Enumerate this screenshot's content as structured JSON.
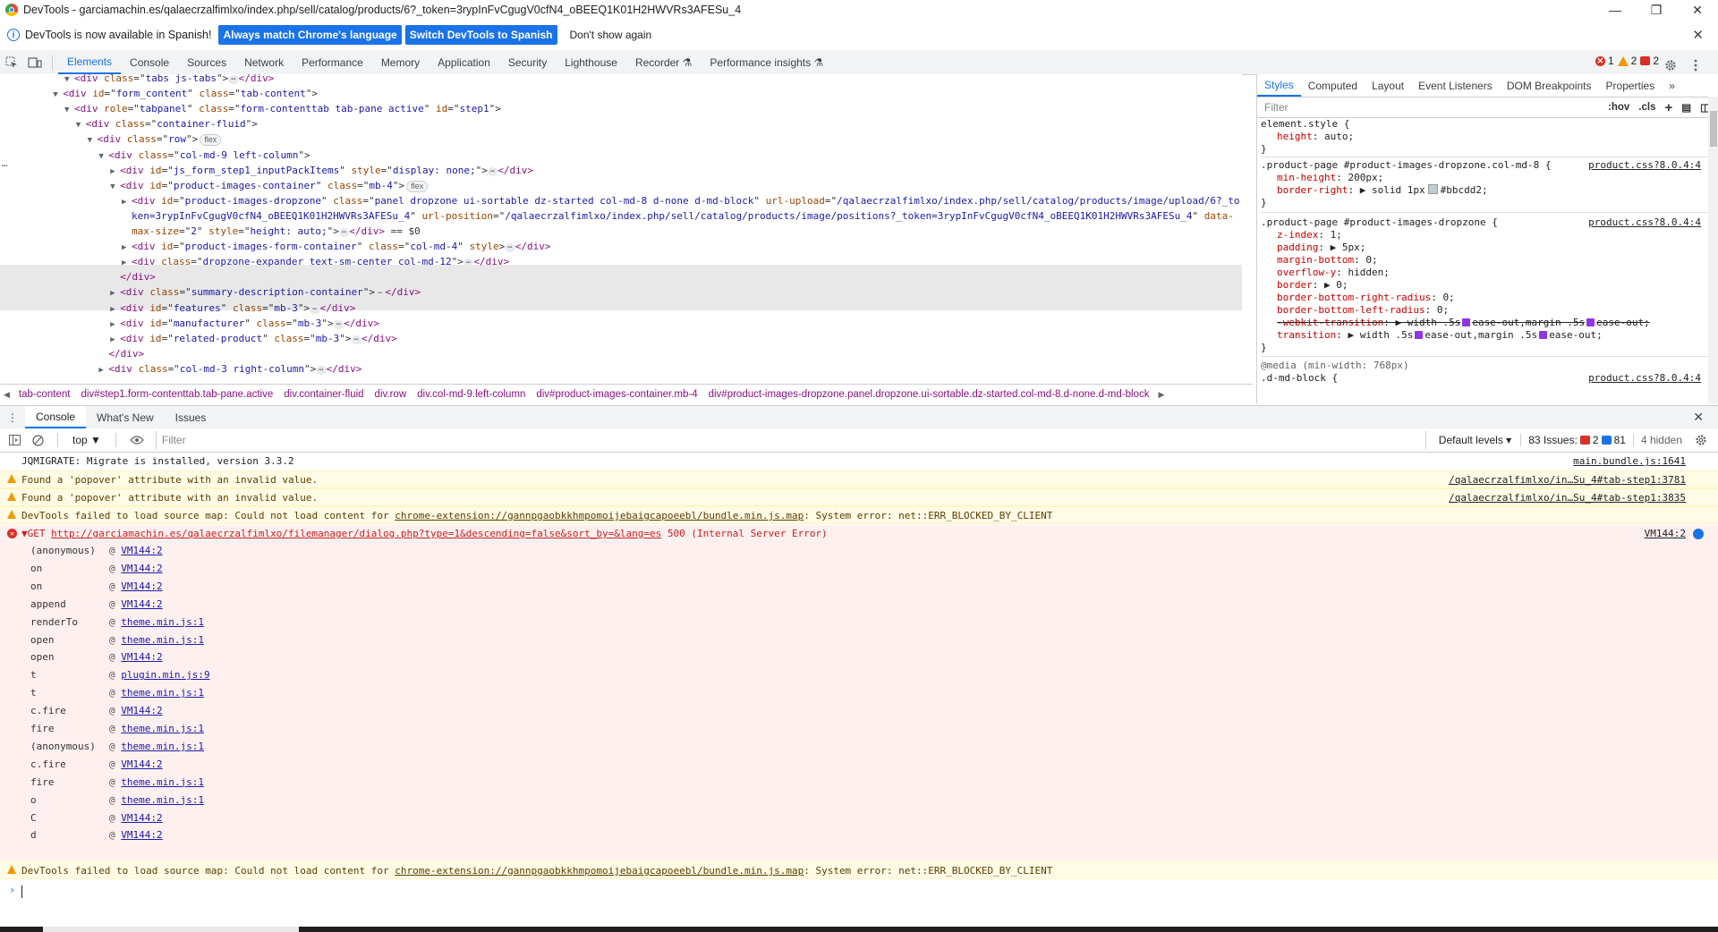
{
  "window": {
    "title": "DevTools - garciamachin.es/qalaecrzalfimlxo/index.php/sell/catalog/products/6?_token=3rypInFvCgugV0cfN4_oBEEQ1K01H2HWVRs3AFESu_4",
    "minimize": "—",
    "restore": "❐",
    "close": "✕"
  },
  "infobar": {
    "message": "DevTools is now available in Spanish!",
    "button_match": "Always match Chrome's language",
    "button_switch": "Switch DevTools to Spanish",
    "button_dismiss": "Don't show again",
    "close": "✕"
  },
  "main_tabs": [
    "Elements",
    "Console",
    "Sources",
    "Network",
    "Performance",
    "Memory",
    "Application",
    "Security",
    "Lighthouse",
    "Recorder ⚗",
    "Performance insights ⚗"
  ],
  "badges": {
    "errors": "1",
    "warnings": "2",
    "issues": "2"
  },
  "dom_lines": [
    {
      "indent": 5,
      "tri": "▼",
      "html": "<div class=\"tabs js-tabs\">…</div>",
      "parts": [
        [
          "tag",
          "<div "
        ],
        [
          "attr",
          "class"
        ],
        [
          "plain",
          "=\""
        ],
        [
          "val",
          "tabs js-tabs"
        ],
        [
          "plain",
          "\">"
        ],
        [
          "dots",
          "⋯"
        ],
        [
          "tag",
          "</div>"
        ]
      ]
    },
    {
      "indent": 4,
      "tri": "▼",
      "parts": [
        [
          "tag",
          "<div "
        ],
        [
          "attr",
          "id"
        ],
        [
          "plain",
          "=\""
        ],
        [
          "val",
          "form_content"
        ],
        [
          "plain",
          "\" "
        ],
        [
          "attr",
          "class"
        ],
        [
          "plain",
          "=\""
        ],
        [
          "val",
          "tab-content"
        ],
        [
          "plain",
          "\">"
        ]
      ]
    },
    {
      "indent": 5,
      "tri": "▼",
      "parts": [
        [
          "tag",
          "<div "
        ],
        [
          "attr",
          "role"
        ],
        [
          "plain",
          "=\""
        ],
        [
          "val",
          "tabpanel"
        ],
        [
          "plain",
          "\" "
        ],
        [
          "attr",
          "class"
        ],
        [
          "plain",
          "=\""
        ],
        [
          "val",
          "form-contenttab tab-pane active"
        ],
        [
          "plain",
          "\" "
        ],
        [
          "attr",
          "id"
        ],
        [
          "plain",
          "=\""
        ],
        [
          "val",
          "step1"
        ],
        [
          "plain",
          "\">"
        ]
      ]
    },
    {
      "indent": 6,
      "tri": "▼",
      "parts": [
        [
          "tag",
          "<div "
        ],
        [
          "attr",
          "class"
        ],
        [
          "plain",
          "=\""
        ],
        [
          "val",
          "container-fluid"
        ],
        [
          "plain",
          "\">"
        ]
      ]
    },
    {
      "indent": 7,
      "tri": "▼",
      "parts": [
        [
          "tag",
          "<div "
        ],
        [
          "attr",
          "class"
        ],
        [
          "plain",
          "=\""
        ],
        [
          "val",
          "row"
        ],
        [
          "plain",
          "\">"
        ],
        [
          "pill",
          "flex"
        ]
      ]
    },
    {
      "indent": 8,
      "tri": "▼",
      "parts": [
        [
          "tag",
          "<div "
        ],
        [
          "attr",
          "class"
        ],
        [
          "plain",
          "=\""
        ],
        [
          "val",
          "col-md-9 left-column"
        ],
        [
          "plain",
          "\">"
        ]
      ]
    },
    {
      "indent": 9,
      "tri": "▶",
      "parts": [
        [
          "tag",
          "<div "
        ],
        [
          "attr",
          "id"
        ],
        [
          "plain",
          "=\""
        ],
        [
          "val",
          "js_form_step1_inputPackItems"
        ],
        [
          "plain",
          "\" "
        ],
        [
          "attr",
          "style"
        ],
        [
          "plain",
          "=\""
        ],
        [
          "val",
          "display: none;"
        ],
        [
          "plain",
          "\">"
        ],
        [
          "dots",
          "⋯"
        ],
        [
          "tag",
          "</div>"
        ]
      ]
    },
    {
      "indent": 9,
      "tri": "▼",
      "parts": [
        [
          "tag",
          "<div "
        ],
        [
          "attr",
          "id"
        ],
        [
          "plain",
          "=\""
        ],
        [
          "val",
          "product-images-container"
        ],
        [
          "plain",
          "\" "
        ],
        [
          "attr",
          "class"
        ],
        [
          "plain",
          "=\""
        ],
        [
          "val",
          "mb-4"
        ],
        [
          "plain",
          "\">"
        ],
        [
          "pill",
          "flex"
        ]
      ]
    },
    {
      "indent": 10,
      "tri": "▶",
      "parts": [
        [
          "tag",
          "<div "
        ],
        [
          "attr",
          "id"
        ],
        [
          "plain",
          "=\""
        ],
        [
          "val",
          "product-images-dropzone"
        ],
        [
          "plain",
          "\" "
        ],
        [
          "attr",
          "class"
        ],
        [
          "plain",
          "=\""
        ],
        [
          "val",
          "panel dropzone ui-sortable dz-started col-md-8 d-none d-md-block"
        ],
        [
          "plain",
          "\" "
        ],
        [
          "attr",
          "url-upload"
        ],
        [
          "plain",
          "=\""
        ],
        [
          "val",
          "/qalaecrzalfimlxo/index.php/sell/catalog/products/image/upload/6?_to"
        ]
      ]
    },
    {
      "indent": 10,
      "tri": "",
      "parts": [
        [
          "val",
          "ken=3rypInFvCgugV0cfN4_oBEEQ1K01H2HWVRs3AFESu_4"
        ],
        [
          "plain",
          "\" "
        ],
        [
          "attr",
          "url-position"
        ],
        [
          "plain",
          "=\""
        ],
        [
          "val",
          "/qalaecrzalfimlxo/index.php/sell/catalog/products/image/positions?_token=3rypInFvCgugV0cfN4_oBEEQ1K01H2HWVRs3AFESu_4"
        ],
        [
          "plain",
          "\" "
        ],
        [
          "attr",
          "data-"
        ]
      ]
    },
    {
      "indent": 10,
      "tri": "",
      "parts": [
        [
          "attr",
          "max-size"
        ],
        [
          "plain",
          "=\""
        ],
        [
          "val",
          "2"
        ],
        [
          "plain",
          "\" "
        ],
        [
          "attr",
          "style"
        ],
        [
          "plain",
          "=\""
        ],
        [
          "val",
          "height: auto;"
        ],
        [
          "plain",
          "\">"
        ],
        [
          "dots",
          "⋯"
        ],
        [
          "tag",
          "</div>"
        ],
        [
          "plain",
          " == $0"
        ]
      ]
    },
    {
      "indent": 10,
      "tri": "▶",
      "parts": [
        [
          "tag",
          "<div "
        ],
        [
          "attr",
          "id"
        ],
        [
          "plain",
          "=\""
        ],
        [
          "val",
          "product-images-form-container"
        ],
        [
          "plain",
          "\" "
        ],
        [
          "attr",
          "class"
        ],
        [
          "plain",
          "=\""
        ],
        [
          "val",
          "col-md-4"
        ],
        [
          "plain",
          "\" "
        ],
        [
          "attr",
          "style"
        ],
        [
          "plain",
          ">"
        ],
        [
          "dots",
          "⋯"
        ],
        [
          "tag",
          "</div>"
        ]
      ]
    },
    {
      "indent": 10,
      "tri": "▶",
      "parts": [
        [
          "tag",
          "<div "
        ],
        [
          "attr",
          "class"
        ],
        [
          "plain",
          "=\""
        ],
        [
          "val",
          "dropzone-expander text-sm-center col-md-12"
        ],
        [
          "plain",
          "\">"
        ],
        [
          "dots",
          "⋯"
        ],
        [
          "tag",
          "</div>"
        ]
      ]
    },
    {
      "indent": 9,
      "tri": "",
      "parts": [
        [
          "tag",
          "</div>"
        ]
      ]
    },
    {
      "indent": 9,
      "tri": "▶",
      "parts": [
        [
          "tag",
          "<div "
        ],
        [
          "attr",
          "class"
        ],
        [
          "plain",
          "=\""
        ],
        [
          "val",
          "summary-description-container"
        ],
        [
          "plain",
          "\">"
        ],
        [
          "dots",
          "⋯"
        ],
        [
          "tag",
          "</div>"
        ]
      ]
    },
    {
      "indent": 9,
      "tri": "▶",
      "parts": [
        [
          "tag",
          "<div "
        ],
        [
          "attr",
          "id"
        ],
        [
          "plain",
          "=\""
        ],
        [
          "val",
          "features"
        ],
        [
          "plain",
          "\" "
        ],
        [
          "attr",
          "class"
        ],
        [
          "plain",
          "=\""
        ],
        [
          "val",
          "mb-3"
        ],
        [
          "plain",
          "\">"
        ],
        [
          "dots",
          "⋯"
        ],
        [
          "tag",
          "</div>"
        ]
      ]
    },
    {
      "indent": 9,
      "tri": "▶",
      "parts": [
        [
          "tag",
          "<div "
        ],
        [
          "attr",
          "id"
        ],
        [
          "plain",
          "=\""
        ],
        [
          "val",
          "manufacturer"
        ],
        [
          "plain",
          "\" "
        ],
        [
          "attr",
          "class"
        ],
        [
          "plain",
          "=\""
        ],
        [
          "val",
          "mb-3"
        ],
        [
          "plain",
          "\">"
        ],
        [
          "dots",
          "⋯"
        ],
        [
          "tag",
          "</div>"
        ]
      ]
    },
    {
      "indent": 9,
      "tri": "▶",
      "parts": [
        [
          "tag",
          "<div "
        ],
        [
          "attr",
          "id"
        ],
        [
          "plain",
          "=\""
        ],
        [
          "val",
          "related-product"
        ],
        [
          "plain",
          "\" "
        ],
        [
          "attr",
          "class"
        ],
        [
          "plain",
          "=\""
        ],
        [
          "val",
          "mb-3"
        ],
        [
          "plain",
          "\">"
        ],
        [
          "dots",
          "⋯"
        ],
        [
          "tag",
          "</div>"
        ]
      ]
    },
    {
      "indent": 8,
      "tri": "",
      "parts": [
        [
          "tag",
          "</div>"
        ]
      ]
    },
    {
      "indent": 8,
      "tri": "▶",
      "parts": [
        [
          "tag",
          "<div "
        ],
        [
          "attr",
          "class"
        ],
        [
          "plain",
          "=\""
        ],
        [
          "val",
          "col-md-3 right-column"
        ],
        [
          "plain",
          "\">"
        ],
        [
          "dots",
          "⋯"
        ],
        [
          "tag",
          "</div>"
        ]
      ]
    }
  ],
  "breadcrumb": [
    "tab-content",
    "div#step1.form-contenttab.tab-pane.active",
    "div.container-fluid",
    "div.row",
    "div.col-md-9.left-column",
    "div#product-images-container.mb-4",
    "div#product-images-dropzone.panel.dropzone.ui-sortable.dz-started.col-md-8.d-none.d-md-block"
  ],
  "styles_tabs": [
    "Styles",
    "Computed",
    "Layout",
    "Event Listeners",
    "DOM Breakpoints",
    "Properties"
  ],
  "styles_filter": {
    "placeholder": "Filter",
    "hov": ":hov",
    "cls": ".cls"
  },
  "styles": {
    "element_style": "element.style {",
    "element_prop": "height",
    "element_val": "auto;",
    "rule1_sel": ".product-page #product-images-dropzone.col-md-8 {",
    "rule1_src": "product.css?8.0.4:4",
    "rule1_props": [
      [
        "min-height",
        "200px;"
      ],
      [
        "border-right",
        "▶ solid 1px",
        "#bbcdd2;"
      ]
    ],
    "rule2_sel": ".product-page #product-images-dropzone {",
    "rule2_src": "product.css?8.0.4:4",
    "rule2_props": [
      [
        "z-index",
        "1;"
      ],
      [
        "padding",
        "▶ 5px;"
      ],
      [
        "margin-bottom",
        "0;"
      ],
      [
        "overflow-y",
        "hidden;"
      ],
      [
        "border",
        "▶ 0;"
      ],
      [
        "border-bottom-right-radius",
        "0;"
      ],
      [
        "border-bottom-left-radius",
        "0;"
      ]
    ],
    "rule2_strike_prop": "-webkit-transition",
    "rule2_strike_val1": "▶ width .5s",
    "rule2_strike_val2": "ease-out,margin .5s",
    "rule2_strike_val3": "ease-out;",
    "rule2_trans_prop": "transition",
    "rule2_trans_val1": "▶ width .5s",
    "rule2_trans_val2": "ease-out,margin .5s",
    "rule2_trans_val3": "ease-out;",
    "media": "@media (min-width: 768px)",
    "rule3_sel": ".d-md-block {",
    "rule3_src": "product.css?8.0.4:4",
    "close": "}"
  },
  "drawer_tabs": [
    "Console",
    "What's New",
    "Issues"
  ],
  "console_toolbar": {
    "context": "top ▼",
    "filter_placeholder": "Filter",
    "levels": "Default levels ▾",
    "issues_label": "83 Issues:",
    "issues_err": "2",
    "issues_info": "81",
    "hidden": "4 hidden"
  },
  "console": {
    "jqmigrate": "JQMIGRATE: Migrate is installed, version 3.3.2",
    "jqmigrate_src": "main.bundle.js:1641",
    "warn1": "Found a 'popover' attribute with an invalid value.",
    "warn1_src": "/qalaecrzalfimlxo/in…Su_4#tab-step1:3781",
    "warn2": "Found a 'popover' attribute with an invalid value.",
    "warn2_src": "/qalaecrzalfimlxo/in…Su_4#tab-step1:3835",
    "warn3_pre": "DevTools failed to load source map: Could not load content for ",
    "warn3_link": "chrome-extension://gannpgaobkkhmpomoijebaigcapoeebl/bundle.min.js.map",
    "warn3_post": ": System error: net::ERR_BLOCKED_BY_CLIENT",
    "error_pre": "▼GET ",
    "error_link": "http://garciamachin.es/qalaecrzalfimlxo/filemanager/dialog.php?type=1&descending=false&sort_by=&lang=es",
    "error_post": " 500 (Internal Server Error)",
    "error_src": "VM144:2",
    "stack": [
      [
        "(anonymous)",
        "VM144:2"
      ],
      [
        "on",
        "VM144:2"
      ],
      [
        "on",
        "VM144:2"
      ],
      [
        "append",
        "VM144:2"
      ],
      [
        "renderTo",
        "theme.min.js:1"
      ],
      [
        "open",
        "theme.min.js:1"
      ],
      [
        "open",
        "VM144:2"
      ],
      [
        "t",
        "plugin.min.js:9"
      ],
      [
        "t",
        "theme.min.js:1"
      ],
      [
        "c.fire",
        "VM144:2"
      ],
      [
        "fire",
        "theme.min.js:1"
      ],
      [
        "(anonymous)",
        "theme.min.js:1"
      ],
      [
        "c.fire",
        "VM144:2"
      ],
      [
        "fire",
        "theme.min.js:1"
      ],
      [
        "o",
        "theme.min.js:1"
      ],
      [
        "C",
        "VM144:2"
      ],
      [
        "d",
        "VM144:2"
      ]
    ],
    "stack_at": "@",
    "warn4_pre": "DevTools failed to load source map: Could not load content for ",
    "warn4_link": "chrome-extension://gannpgaobkkhmpomoijebaigcapoeebl/bundle.min.js.map",
    "warn4_post": ": System error: net::ERR_BLOCKED_BY_CLIENT",
    "prompt": "›"
  }
}
